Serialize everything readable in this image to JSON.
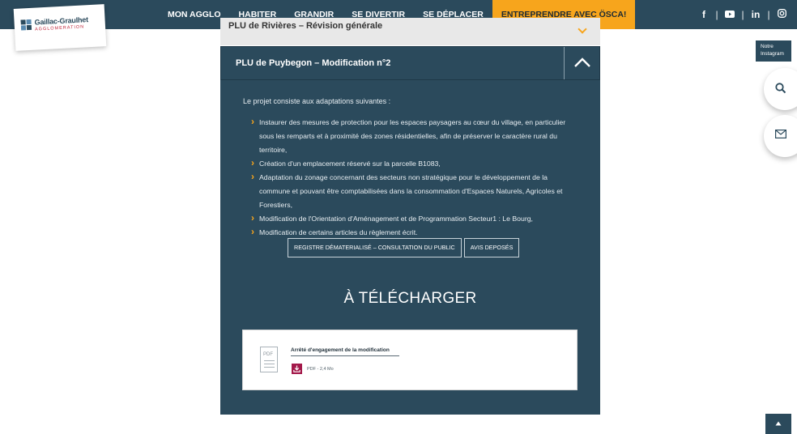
{
  "brand": {
    "name": "Gaillac-Graulhet",
    "sub": "AGGLOMERATION",
    "colors": {
      "navy": "#2b4a5c",
      "accent": "#f7a51c",
      "download": "#a3194a"
    }
  },
  "nav": {
    "items": [
      {
        "label": "MON AGGLO"
      },
      {
        "label": "HABITER"
      },
      {
        "label": "GRANDIR"
      },
      {
        "label": "SE DIVERTIR"
      },
      {
        "label": "SE DÉPLACER"
      },
      {
        "label": "ENTREPRENDRE AVEC ÖSCA!"
      }
    ]
  },
  "social": {
    "icons": [
      "facebook-icon",
      "youtube-icon",
      "linkedin-icon",
      "instagram-icon"
    ],
    "labels": [
      "f",
      "▶",
      "in",
      "◎"
    ],
    "tooltip_line1": "Notre",
    "tooltip_line2": "Instagram"
  },
  "floating": {
    "search_icon": "search-icon",
    "mail_icon": "mail-icon"
  },
  "accordion": {
    "previous_title": "PLU de Rivières – Révision générale",
    "title": "PLU de Puybegon – Modification n°2",
    "intro": "Le projet consiste aux adaptations suivantes :",
    "points": [
      "Instaurer des mesures de protection pour les espaces paysagers au cœur du village, en particulier sous les remparts et à proximité des zones résidentielles, afin de préserver le caractère rural du territoire,",
      "Création d'un emplacement réservé sur la parcelle B1083,",
      "Adaptation du zonage concernant des secteurs non stratégique pour le développement de la commune et pouvant être comptabilisées dans la consommation d'Espaces Naturels, Agricoles et Forestiers,",
      "Modification de l'Orientation d'Aménagement et de Programmation Secteur1 : Le Bourg,",
      "Modification de certains articles du règlement écrit."
    ],
    "buttons": {
      "registry": "REGISTRE DÉMATERIALISÉ – CONSULTATION DU PUBLIC",
      "notices": "AVIS DEPOSÉS"
    }
  },
  "downloads": {
    "heading": "À TÉLÉCHARGER",
    "file": {
      "icon_label": "PDF",
      "name": "Arrêté d'engagement de la modification",
      "meta": "PDF - 2,4 Mo"
    }
  },
  "scroll_top": {
    "icon": "chevron-up-icon"
  }
}
